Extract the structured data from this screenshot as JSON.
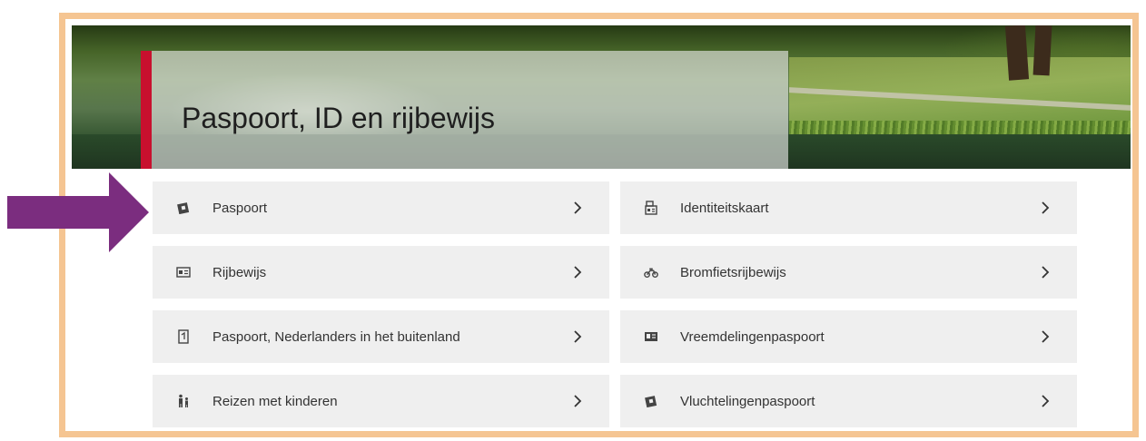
{
  "header": {
    "title": "Paspoort, ID en rijbewijs",
    "accent_color": "#c8102e",
    "frame_color": "#f5c592"
  },
  "annotation": {
    "arrow_color": "#7b2d7f"
  },
  "tiles": [
    {
      "label": "Paspoort",
      "icon": "passport-icon"
    },
    {
      "label": "Identiteitskaart",
      "icon": "id-card-icon"
    },
    {
      "label": "Rijbewijs",
      "icon": "drivers-license-icon"
    },
    {
      "label": "Bromfietsrijbewijs",
      "icon": "moped-icon"
    },
    {
      "label": "Paspoort, Nederlanders in het buitenland",
      "icon": "document-icon"
    },
    {
      "label": "Vreemdelingenpaspoort",
      "icon": "alien-passport-icon"
    },
    {
      "label": "Reizen met kinderen",
      "icon": "parent-child-icon"
    },
    {
      "label": "Vluchtelingenpaspoort",
      "icon": "refugee-passport-icon"
    }
  ]
}
